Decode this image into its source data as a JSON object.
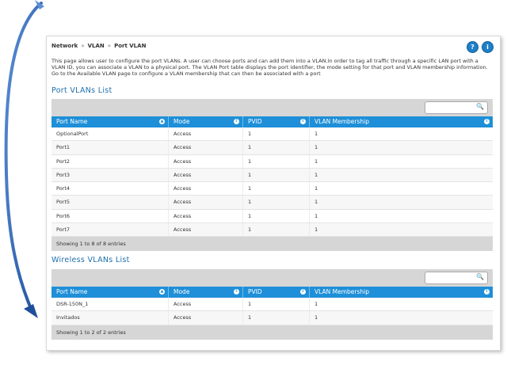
{
  "breadcrumb": {
    "items": [
      "Network",
      "VLAN",
      "Port VLAN"
    ],
    "separator": "»"
  },
  "header_icons": {
    "help": "?",
    "info": "i"
  },
  "intro": "This page allows user to configure the port VLANs. A user can choose ports and can add them into a VLAN.In order to tag all traffic through a specific LAN port with a VLAN ID, you can associate a VLAN to a physical port. The VLAN Port table displays the port identifier, the mode setting for that port and VLAN membership information. Go to the Available VLAN page to configure a VLAN membership that can then be associated with a port",
  "port_vlans": {
    "title": "Port VLANs List",
    "columns": [
      "Port Name",
      "Mode",
      "PVID",
      "VLAN Membership"
    ],
    "rows": [
      [
        "OptionalPort",
        "Access",
        "1",
        "1"
      ],
      [
        "Port1",
        "Access",
        "1",
        "1"
      ],
      [
        "Port2",
        "Access",
        "1",
        "1"
      ],
      [
        "Port3",
        "Access",
        "1",
        "1"
      ],
      [
        "Port4",
        "Access",
        "1",
        "1"
      ],
      [
        "Port5",
        "Access",
        "1",
        "1"
      ],
      [
        "Port6",
        "Access",
        "1",
        "1"
      ],
      [
        "Port7",
        "Access",
        "1",
        "1"
      ]
    ],
    "footer": "Showing 1 to 8 of 8 entries"
  },
  "wireless_vlans": {
    "title": "Wireless VLANs List",
    "columns": [
      "Port Name",
      "Mode",
      "PVID",
      "VLAN Membership"
    ],
    "rows": [
      [
        "DSR-150N_1",
        "Access",
        "1",
        "1"
      ],
      [
        "Invitados",
        "Access",
        "1",
        "1"
      ]
    ],
    "footer": "Showing 1 to 2 of 2 entries"
  },
  "colors": {
    "accent": "#1e8fd8",
    "title": "#1d6fae",
    "arrow": "#2a64b8"
  }
}
